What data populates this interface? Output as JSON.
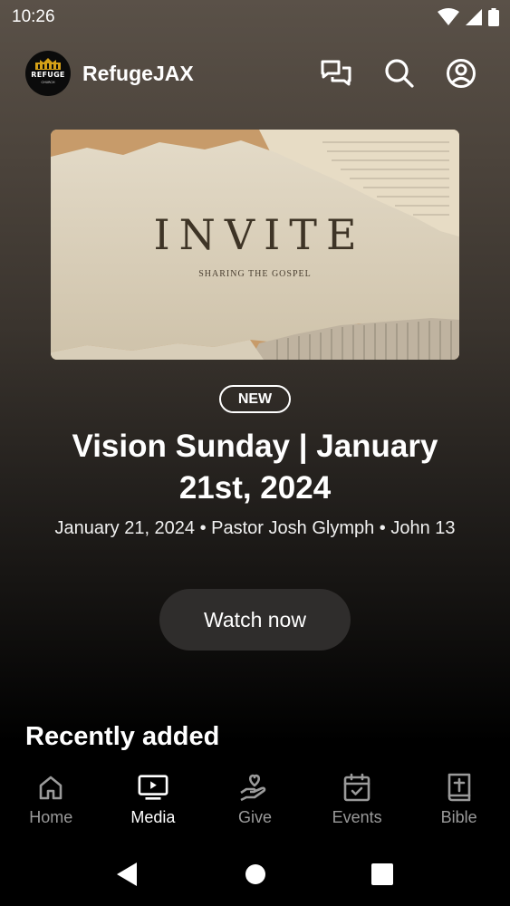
{
  "status_bar": {
    "time": "10:26",
    "icons": [
      "wifi-icon",
      "cellular-signal-icon",
      "battery-icon"
    ]
  },
  "header": {
    "logo_text": "REFUGE",
    "logo_subtext": "CHURCH",
    "app_name": "RefugeJAX",
    "actions": [
      "chat-icon",
      "search-icon",
      "account-icon"
    ]
  },
  "featured": {
    "artwork_title": "INVITE",
    "artwork_subtitle": "SHARING THE GOSPEL",
    "badge": "NEW",
    "title": "Vision Sunday | January 21st, 2024",
    "meta": "January 21, 2024 • Pastor Josh Glymph • John 13",
    "watch_label": "Watch now"
  },
  "recent": {
    "title": "Recently added"
  },
  "bottom_nav": {
    "active": "Media",
    "items": [
      {
        "label": "Home",
        "icon": "home-icon"
      },
      {
        "label": "Media",
        "icon": "media-icon"
      },
      {
        "label": "Give",
        "icon": "give-icon"
      },
      {
        "label": "Events",
        "icon": "calendar-icon"
      },
      {
        "label": "Bible",
        "icon": "bible-icon"
      }
    ]
  },
  "system_nav": [
    "back-icon",
    "home-circle-icon",
    "recents-icon"
  ],
  "colors": {
    "accent": "#d4a017",
    "active_nav": "#ffffff",
    "inactive_nav": "#9a9a9a",
    "button_bg": "#2f2d2c"
  }
}
